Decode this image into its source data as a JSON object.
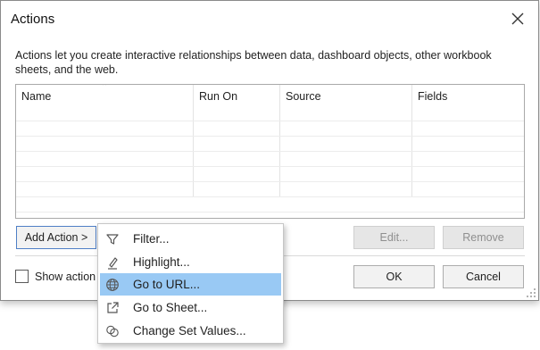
{
  "dialog": {
    "title": "Actions",
    "description": "Actions let you create interactive relationships between data, dashboard objects, other workbook sheets, and the web."
  },
  "table": {
    "columns": [
      "Name",
      "Run On",
      "Source",
      "Fields"
    ]
  },
  "buttons": {
    "add_action": "Add Action >",
    "edit": "Edit...",
    "remove": "Remove",
    "ok": "OK",
    "cancel": "Cancel"
  },
  "checkbox": {
    "label": "Show action",
    "checked": false
  },
  "menu": {
    "items": [
      {
        "label": "Filter...",
        "icon": "filter-icon"
      },
      {
        "label": "Highlight...",
        "icon": "highlighter-icon"
      },
      {
        "label": "Go to URL...",
        "icon": "globe-icon",
        "selected": true
      },
      {
        "label": "Go to Sheet...",
        "icon": "external-link-icon"
      },
      {
        "label": "Change Set Values...",
        "icon": "set-values-icon"
      }
    ]
  },
  "colors": {
    "menu_selected": "#99c9f4",
    "add_action_border": "#4f7fc6"
  }
}
